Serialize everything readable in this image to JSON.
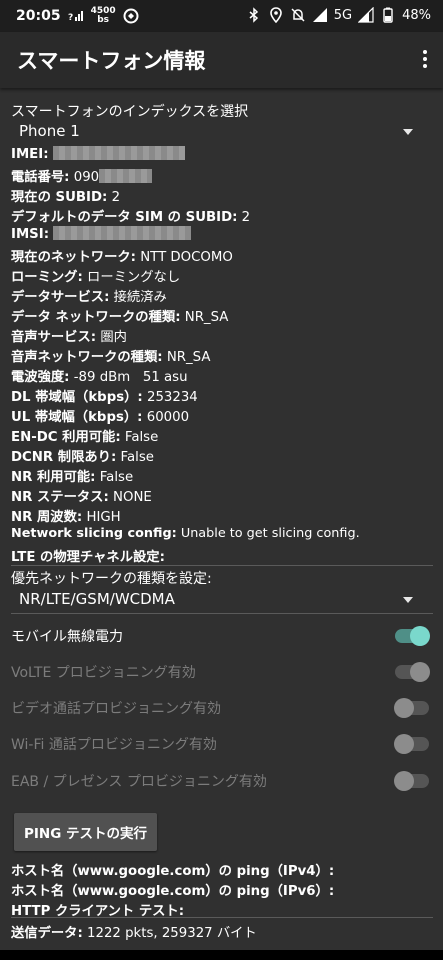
{
  "status_bar": {
    "time": "20:05",
    "data_speed_top": "4500",
    "data_speed_bottom": "bs",
    "network": "5G",
    "battery": "48%"
  },
  "app": {
    "title": "スマートフォン情報"
  },
  "phone_index": {
    "label": "スマートフォンのインデックスを選択",
    "value": "Phone 1"
  },
  "info": {
    "imei_label": "IMEI:",
    "phone_number_label": "電話番号:",
    "phone_number_value": "090",
    "subid_label": "現在の SUBID:",
    "subid_value": "2",
    "default_data_subid_label": "デフォルトのデータ SIM の SUBID:",
    "default_data_subid_value": "2",
    "imsi_label": "IMSI:",
    "network_label": "現在のネットワーク:",
    "network_value": "NTT DOCOMO",
    "roaming_label": "ローミング:",
    "roaming_value": "ローミングなし",
    "data_service_label": "データサービス:",
    "data_service_value": "接続済み",
    "data_network_type_label": "データ ネットワークの種類:",
    "data_network_type_value": "NR_SA",
    "voice_service_label": "音声サービス:",
    "voice_service_value": "圏内",
    "voice_network_type_label": "音声ネットワークの種類:",
    "voice_network_type_value": "NR_SA",
    "signal_label": "電波強度:",
    "signal_value": "-89 dBm   51 asu",
    "dl_label": "DL 帯域幅（kbps）:",
    "dl_value": "253234",
    "ul_label": "UL 帯域幅（kbps）:",
    "ul_value": "60000",
    "endc_label": "EN-DC 利用可能:",
    "endc_value": "False",
    "dcnr_label": "DCNR 制限あり:",
    "dcnr_value": "False",
    "nr_available_label": "NR 利用可能:",
    "nr_available_value": "False",
    "nr_state_label": "NR ステータス:",
    "nr_state_value": "NONE",
    "nr_freq_label": "NR 周波数:",
    "nr_freq_value": "HIGH",
    "slicing_label": "Network slicing config:",
    "slicing_value": "Unable to get slicing config.",
    "lte_physical_label": "LTE の物理チャネル設定:"
  },
  "preferred_network": {
    "label": "優先ネットワークの種類を設定:",
    "value": "NR/LTE/GSM/WCDMA"
  },
  "toggles": [
    {
      "label": "モバイル無線電力",
      "state": "on",
      "enabled": true
    },
    {
      "label": "VoLTE プロビジョニング有効",
      "state": "on",
      "enabled": false
    },
    {
      "label": "ビデオ通話プロビジョニング有効",
      "state": "off",
      "enabled": false
    },
    {
      "label": "Wi-Fi 通話プロビジョニング有効",
      "state": "off",
      "enabled": false
    },
    {
      "label": "EAB / プレゼンス プロビジョニング有効",
      "state": "off",
      "enabled": false
    }
  ],
  "ping": {
    "button_label": "PING テストの実行",
    "ipv4_label": "ホスト名（www.google.com）の ping（IPv4）:",
    "ipv6_label": "ホスト名（www.google.com）の ping（IPv6）:",
    "http_label": "HTTP クライアント テスト:"
  },
  "sent_data": {
    "label": "送信データ:",
    "value": "1222 pkts, 259327 バイト"
  },
  "colors": {
    "accent": "#7ad8cc",
    "background": "#303030",
    "appbar": "#2a2a2a"
  }
}
